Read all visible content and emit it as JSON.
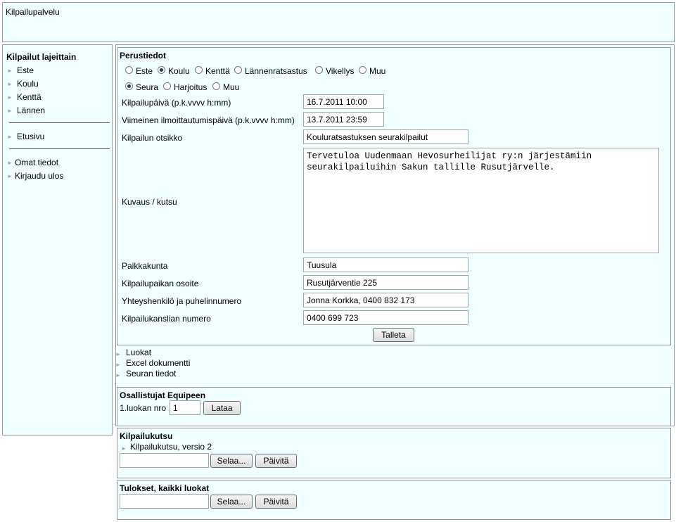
{
  "header": {
    "title": "Kilpailupalvelu"
  },
  "sidebar": {
    "heading": "Kilpailut lajeittain",
    "sports": [
      "Este",
      "Koulu",
      "Kenttä",
      "Lännen"
    ],
    "home": "Etusivu",
    "account": [
      "Omat tiedot",
      "Kirjaudu ulos"
    ]
  },
  "basic": {
    "heading": "Perustiedot",
    "types": [
      {
        "label": "Este",
        "selected": false
      },
      {
        "label": "Koulu",
        "selected": true
      },
      {
        "label": "Kenttä",
        "selected": false
      },
      {
        "label": "Lännenratsastus",
        "selected": false
      },
      {
        "label": "Vikellys",
        "selected": false
      },
      {
        "label": "Muu",
        "selected": false
      }
    ],
    "levels": [
      {
        "label": "Seura",
        "selected": true
      },
      {
        "label": "Harjoitus",
        "selected": false
      },
      {
        "label": "Muu",
        "selected": false
      }
    ],
    "fields": {
      "date_label": "Kilpailupäivä (p.k.vvvv h:mm)",
      "date_value": "16.7.2011 10:00",
      "deadline_label": "Viimeinen ilmoittautumispäivä (p.k.vvvv h:mm)",
      "deadline_value": "13.7.2011 23:59",
      "title_label": "Kilpailun otsikko",
      "title_value": "Kouluratsastuksen seurakilpailut",
      "desc_label": "Kuvaus / kutsu",
      "desc_value": "Tervetuloa Uudenmaan Hevosurheilijat ry:n järjestämiin\nseurakilpailuihin Sakun tallille Rusutjärvelle.",
      "city_label": "Paikkakunta",
      "city_value": "Tuusula",
      "address_label": "Kilpailupaikan osoite",
      "address_value": "Rusutjärventie 225",
      "contact_label": "Yhteyshenkilö ja puhelinnumero",
      "contact_value": "Jonna Korkka, 0400 832 173",
      "office_label": "Kilpailukanslian numero",
      "office_value": "0400 699 723"
    },
    "save_button": "Talleta"
  },
  "sections": [
    "Luokat",
    "Excel dokumentti",
    "Seuran tiedot"
  ],
  "participants": {
    "heading": "Osallistujat Equipeen",
    "class_label": "1.luokan nro",
    "class_value": "1",
    "load_button": "Lataa"
  },
  "invitation": {
    "heading": "Kilpailukutsu",
    "file_link": "Kilpailukutsu, versio 2",
    "browse_button": "Selaa...",
    "update_button": "Päivitä"
  },
  "results": {
    "heading": "Tulokset, kaikki luokat",
    "browse_button": "Selaa...",
    "update_button": "Päivitä"
  }
}
